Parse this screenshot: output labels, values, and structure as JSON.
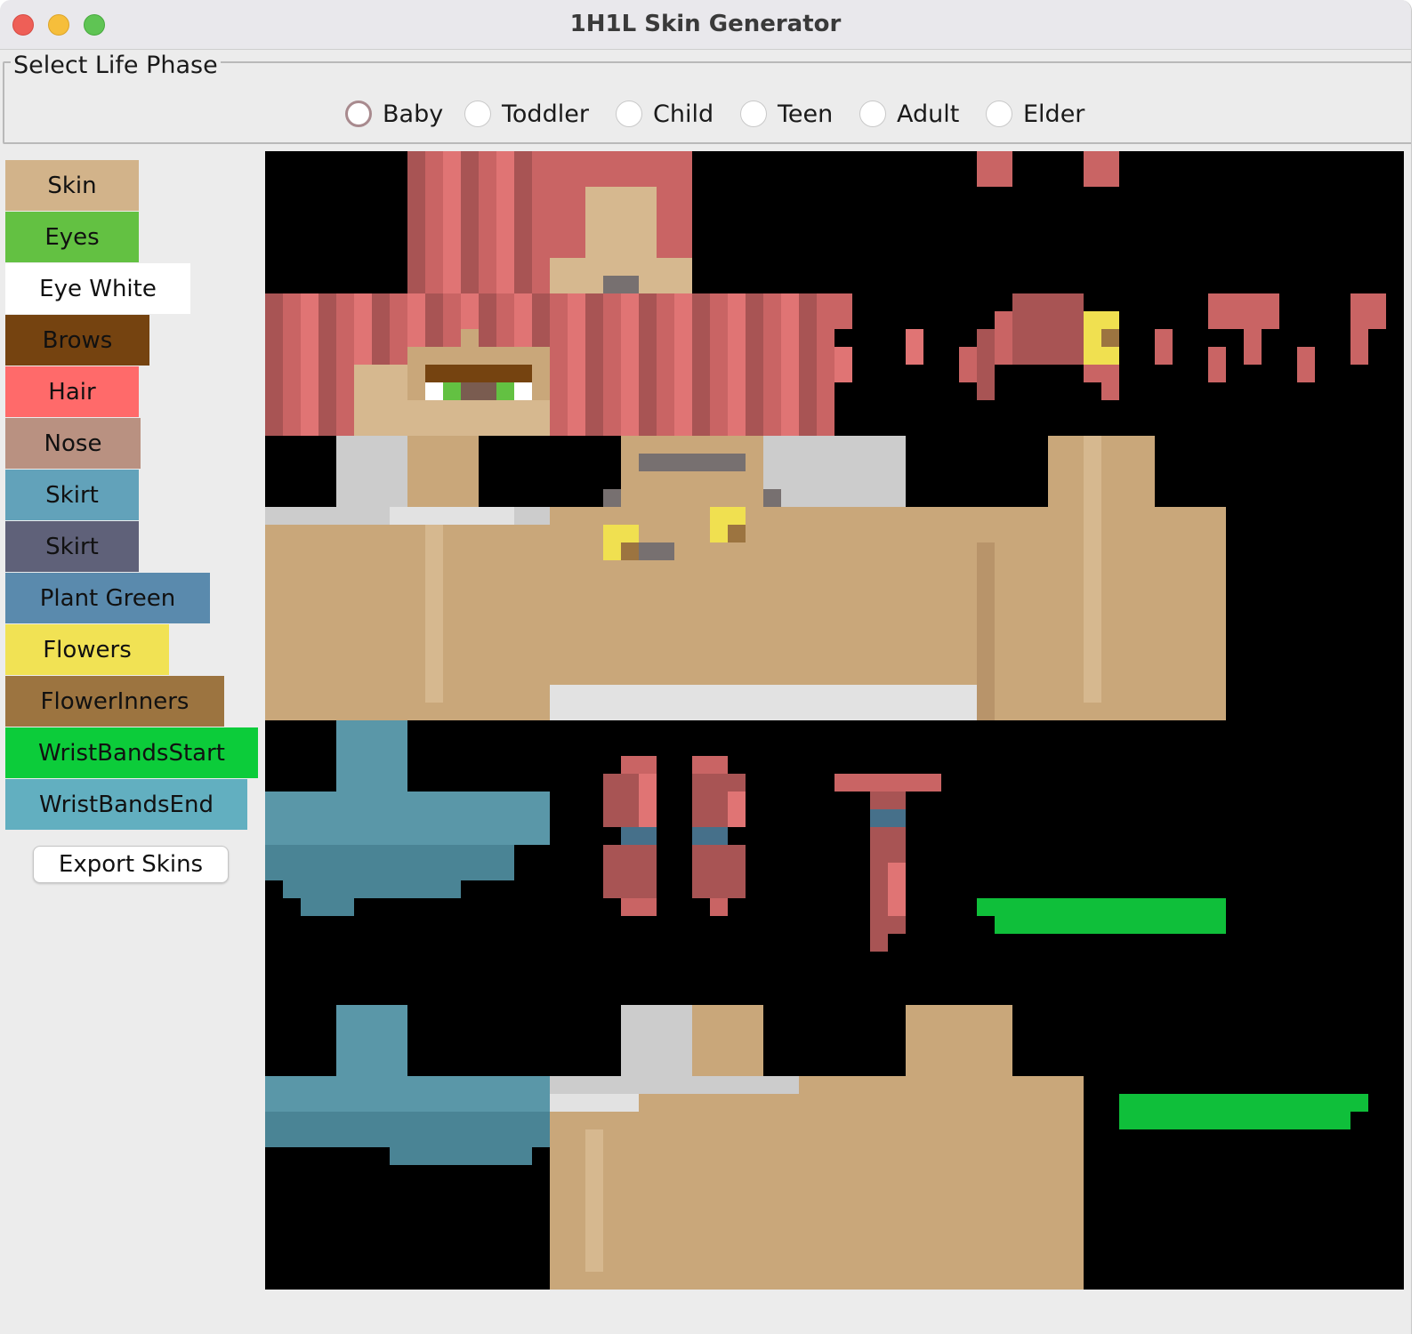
{
  "window": {
    "title": "1H1L Skin Generator"
  },
  "life_phase": {
    "legend": "Select Life Phase",
    "options": [
      "Baby",
      "Toddler",
      "Child",
      "Teen",
      "Adult",
      "Elder"
    ],
    "selected": "Baby"
  },
  "color_buttons": [
    {
      "label": "Skin",
      "color": "#d2b38a"
    },
    {
      "label": "Eyes",
      "color": "#63c142"
    },
    {
      "label": "Eye White",
      "color": "#ffffff"
    },
    {
      "label": "Brows",
      "color": "#754310"
    },
    {
      "label": "Hair",
      "color": "#ff6a6a"
    },
    {
      "label": "Nose",
      "color": "#b99181"
    },
    {
      "label": "Skirt",
      "color": "#62a2ba"
    },
    {
      "label": "Skirt",
      "color": "#5f6179"
    },
    {
      "label": "Plant Green",
      "color": "#5a8aad"
    },
    {
      "label": "Flowers",
      "color": "#f1e254"
    },
    {
      "label": "FlowerInners",
      "color": "#9c7440"
    },
    {
      "label": "WristBandsStart",
      "color": "#0ccc3a"
    },
    {
      "label": "WristBandsEnd",
      "color": "#62afc0"
    }
  ],
  "export_button": {
    "label": "Export Skins"
  },
  "skin_preview": {
    "palette": {
      "background": "#000000",
      "hair": "#c96464",
      "hair_light": "#e07474",
      "hair_dark": "#a85454",
      "skin": "#c9a77a",
      "skin_light": "#d6b88f",
      "skin_dark": "#b8946a",
      "brow": "#754310",
      "nose": "#7a5c50",
      "mouth": "#6e5b53",
      "eye_white": "#ffffff",
      "eye": "#63c142",
      "gray": "#cccccc",
      "gray_light": "#e2e2e2",
      "gray_mid": "#bdbdbd",
      "teal": "#5a97a8",
      "teal_dark": "#4a8495",
      "wrist_blue": "#46708a",
      "flower": "#f0e050",
      "flower_inner": "#9c7440",
      "green": "#0fbf3a",
      "dark_gray": "#777070"
    }
  }
}
